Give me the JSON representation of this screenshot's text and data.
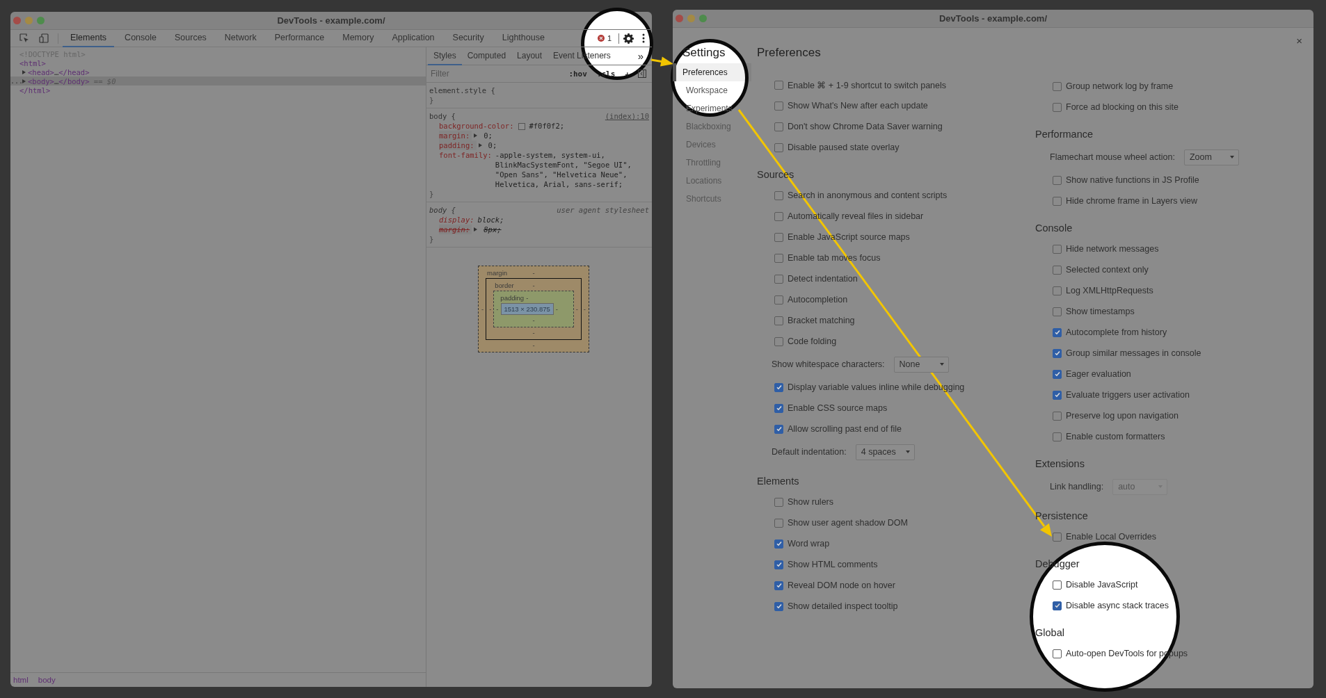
{
  "left_window": {
    "title": "DevTools - example.com/",
    "tabs": [
      {
        "label": "Elements",
        "selected": true
      },
      {
        "label": "Console",
        "selected": false
      },
      {
        "label": "Sources",
        "selected": false
      },
      {
        "label": "Network",
        "selected": false
      },
      {
        "label": "Performance",
        "selected": false
      },
      {
        "label": "Memory",
        "selected": false
      },
      {
        "label": "Application",
        "selected": false
      },
      {
        "label": "Security",
        "selected": false
      },
      {
        "label": "Lighthouse",
        "selected": false
      }
    ],
    "error_badge": {
      "count": "1"
    },
    "dom_tree": [
      {
        "tokens": [
          {
            "kind": "doctype",
            "text": "<!DOCTYPE html>"
          }
        ]
      },
      {
        "tokens": [
          {
            "kind": "tag",
            "text": "<html>"
          }
        ],
        "children": [
          {
            "collapsed": true,
            "selected": false,
            "tokens": [
              {
                "kind": "tag",
                "text": "<head>"
              },
              {
                "kind": "text",
                "text": "…"
              },
              {
                "kind": "tag",
                "text": "</head>"
              }
            ]
          },
          {
            "collapsed": true,
            "selected": true,
            "marker": "...",
            "tokens": [
              {
                "kind": "tag",
                "text": "<body>"
              },
              {
                "kind": "text",
                "text": "…"
              },
              {
                "kind": "tag",
                "text": "</body>"
              },
              {
                "kind": "ref",
                "text": " == $0"
              }
            ]
          }
        ],
        "closing": [
          {
            "kind": "tag",
            "text": "</html>"
          }
        ]
      }
    ],
    "breadcrumbs": [
      "html",
      "body"
    ],
    "style_tabs": [
      {
        "label": "Styles",
        "selected": true
      },
      {
        "label": "Computed",
        "selected": false
      },
      {
        "label": "Layout",
        "selected": false
      },
      {
        "label": "Event Listeners",
        "selected": false
      }
    ],
    "more_tabs": "»",
    "filter": {
      "placeholder": "Filter"
    },
    "filter_buttons": [
      ":hov",
      ".cls",
      "+"
    ],
    "rules": [
      {
        "selector": "element.style {",
        "close": "}",
        "user_agent": false
      },
      {
        "selector": "body {",
        "source": "(index):10",
        "close": "}",
        "user_agent": false,
        "declarations": [
          {
            "property": "background-color:",
            "value": "#f0f0f2;",
            "swatch": true,
            "expandable": false,
            "overridden": false
          },
          {
            "property": "margin:",
            "value": "0;",
            "swatch": false,
            "expandable": true,
            "overridden": false
          },
          {
            "property": "padding:",
            "value": "0;",
            "swatch": false,
            "expandable": true,
            "overridden": false
          },
          {
            "property": "font-family:",
            "value": "-apple-system, system-ui, BlinkMacSystemFont, \"Segoe UI\", \"Open Sans\", \"Helvetica Neue\", Helvetica, Arial, sans-serif;",
            "swatch": false,
            "expandable": false,
            "overridden": false
          }
        ]
      },
      {
        "selector": "body {",
        "source": "user agent stylesheet",
        "close": "}",
        "user_agent": true,
        "declarations": [
          {
            "property": "display:",
            "value": "block;",
            "swatch": false,
            "expandable": false,
            "overridden": false
          },
          {
            "property": "margin:",
            "value": "8px;",
            "swatch": false,
            "expandable": true,
            "overridden": true
          }
        ]
      }
    ],
    "box_model": {
      "margin": {
        "label": "margin",
        "top": "-",
        "right": "-",
        "bottom": "-",
        "left": "-"
      },
      "border": {
        "label": "border",
        "top": "-",
        "right": "-",
        "bottom": "-",
        "left": "-"
      },
      "padding": {
        "label": "padding",
        "top": "-",
        "right": "-",
        "bottom": "-",
        "left": "-"
      },
      "content": "1513 × 230.875"
    }
  },
  "right_window": {
    "title": "DevTools - example.com/",
    "close": "×",
    "sidebar": {
      "title": "Settings",
      "items": [
        {
          "label": "Preferences",
          "selected": true
        },
        {
          "label": "Workspace",
          "selected": false
        },
        {
          "label": "Experiments",
          "selected": false
        },
        {
          "label": "Blackboxing",
          "selected": false
        },
        {
          "label": "Devices",
          "selected": false
        },
        {
          "label": "Throttling",
          "selected": false
        },
        {
          "label": "Locations",
          "selected": false
        },
        {
          "label": "Shortcuts",
          "selected": false
        }
      ]
    },
    "page_title": "Preferences",
    "columns": [
      [
        {
          "items": [
            {
              "kind": "checkbox",
              "label": "Enable ⌘ + 1-9 shortcut to switch panels",
              "checked": false
            },
            {
              "kind": "checkbox",
              "label": "Show What's New after each update",
              "checked": false
            },
            {
              "kind": "checkbox",
              "label": "Don't show Chrome Data Saver warning",
              "checked": false
            },
            {
              "kind": "checkbox",
              "label": "Disable paused state overlay",
              "checked": false
            }
          ]
        },
        {
          "heading": "Sources",
          "items": [
            {
              "kind": "checkbox",
              "label": "Search in anonymous and content scripts",
              "checked": false
            },
            {
              "kind": "checkbox",
              "label": "Automatically reveal files in sidebar",
              "checked": false
            },
            {
              "kind": "checkbox",
              "label": "Enable JavaScript source maps",
              "checked": false
            },
            {
              "kind": "checkbox",
              "label": "Enable tab moves focus",
              "checked": false
            },
            {
              "kind": "checkbox",
              "label": "Detect indentation",
              "checked": false
            },
            {
              "kind": "checkbox",
              "label": "Autocompletion",
              "checked": false
            },
            {
              "kind": "checkbox",
              "label": "Bracket matching",
              "checked": false
            },
            {
              "kind": "checkbox",
              "label": "Code folding",
              "checked": false
            },
            {
              "kind": "select",
              "label": "Show whitespace characters:",
              "value": "None",
              "disabled": false
            },
            {
              "kind": "checkbox",
              "label": "Display variable values inline while debugging",
              "checked": true
            },
            {
              "kind": "checkbox",
              "label": "Enable CSS source maps",
              "checked": true
            },
            {
              "kind": "checkbox",
              "label": "Allow scrolling past end of file",
              "checked": true
            },
            {
              "kind": "select",
              "label": "Default indentation:",
              "value": "4 spaces",
              "disabled": false
            }
          ]
        },
        {
          "heading": "Elements",
          "items": [
            {
              "kind": "checkbox",
              "label": "Show rulers",
              "checked": false
            },
            {
              "kind": "checkbox",
              "label": "Show user agent shadow DOM",
              "checked": false
            },
            {
              "kind": "checkbox",
              "label": "Word wrap",
              "checked": true
            },
            {
              "kind": "checkbox",
              "label": "Show HTML comments",
              "checked": true
            },
            {
              "kind": "checkbox",
              "label": "Reveal DOM node on hover",
              "checked": true
            },
            {
              "kind": "checkbox",
              "label": "Show detailed inspect tooltip",
              "checked": true
            }
          ]
        }
      ],
      [
        {
          "items": [
            {
              "kind": "checkbox",
              "label": "Group network log by frame",
              "checked": false
            },
            {
              "kind": "checkbox",
              "label": "Force ad blocking on this site",
              "checked": false
            }
          ]
        },
        {
          "heading": "Performance",
          "items": [
            {
              "kind": "select",
              "label": "Flamechart mouse wheel action:",
              "value": "Zoom",
              "disabled": false
            },
            {
              "kind": "checkbox",
              "label": "Show native functions in JS Profile",
              "checked": false
            },
            {
              "kind": "checkbox",
              "label": "Hide chrome frame in Layers view",
              "checked": false
            }
          ]
        },
        {
          "heading": "Console",
          "items": [
            {
              "kind": "checkbox",
              "label": "Hide network messages",
              "checked": false
            },
            {
              "kind": "checkbox",
              "label": "Selected context only",
              "checked": false
            },
            {
              "kind": "checkbox",
              "label": "Log XMLHttpRequests",
              "checked": false
            },
            {
              "kind": "checkbox",
              "label": "Show timestamps",
              "checked": false
            },
            {
              "kind": "checkbox",
              "label": "Autocomplete from history",
              "checked": true
            },
            {
              "kind": "checkbox",
              "label": "Group similar messages in console",
              "checked": true
            },
            {
              "kind": "checkbox",
              "label": "Eager evaluation",
              "checked": true
            },
            {
              "kind": "checkbox",
              "label": "Evaluate triggers user activation",
              "checked": true
            },
            {
              "kind": "checkbox",
              "label": "Preserve log upon navigation",
              "checked": false
            },
            {
              "kind": "checkbox",
              "label": "Enable custom formatters",
              "checked": false
            }
          ]
        },
        {
          "heading": "Extensions",
          "items": [
            {
              "kind": "select",
              "label": "Link handling:",
              "value": "auto",
              "disabled": true
            }
          ]
        },
        {
          "heading": "Persistence",
          "items": [
            {
              "kind": "checkbox",
              "label": "Enable Local Overrides",
              "checked": false
            }
          ]
        },
        {
          "heading": "Debugger",
          "items": [
            {
              "kind": "checkbox",
              "label": "Disable JavaScript",
              "checked": false
            },
            {
              "kind": "checkbox",
              "label": "Disable async stack traces",
              "checked": true
            }
          ]
        },
        {
          "heading": "Global",
          "items": [
            {
              "kind": "checkbox",
              "label": "Auto-open DevTools for popups",
              "checked": false
            }
          ]
        }
      ]
    ]
  }
}
